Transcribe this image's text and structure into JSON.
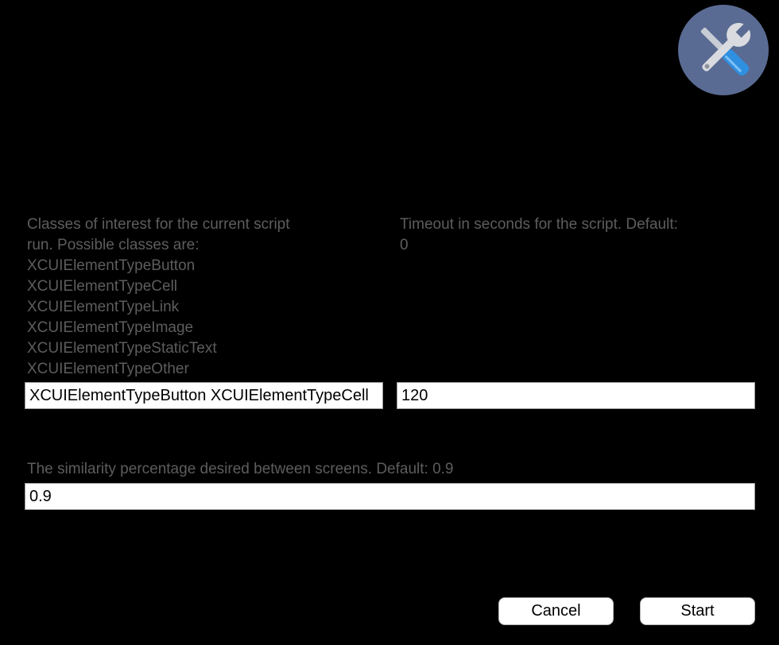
{
  "dialog": {
    "icon": "tools-icon",
    "classes_description": "Classes of interest for the current script\nrun. Possible classes are:\nXCUIElementTypeButton\nXCUIElementTypeCell\nXCUIElementTypeLink\nXCUIElementTypeImage\nXCUIElementTypeStaticText\nXCUIElementTypeOther",
    "classes_value": "XCUIElementTypeButton XCUIElementTypeCell",
    "timeout_description": "Timeout in seconds for the script. Default:\n0",
    "timeout_value": "120",
    "similarity_description": "The similarity percentage desired between screens. Default: 0.9",
    "similarity_value": "0.9",
    "cancel_label": "Cancel",
    "start_label": "Start"
  },
  "colors": {
    "background": "#000000",
    "icon_circle": "#5a6b93",
    "label_text": "#5d5d5d"
  }
}
